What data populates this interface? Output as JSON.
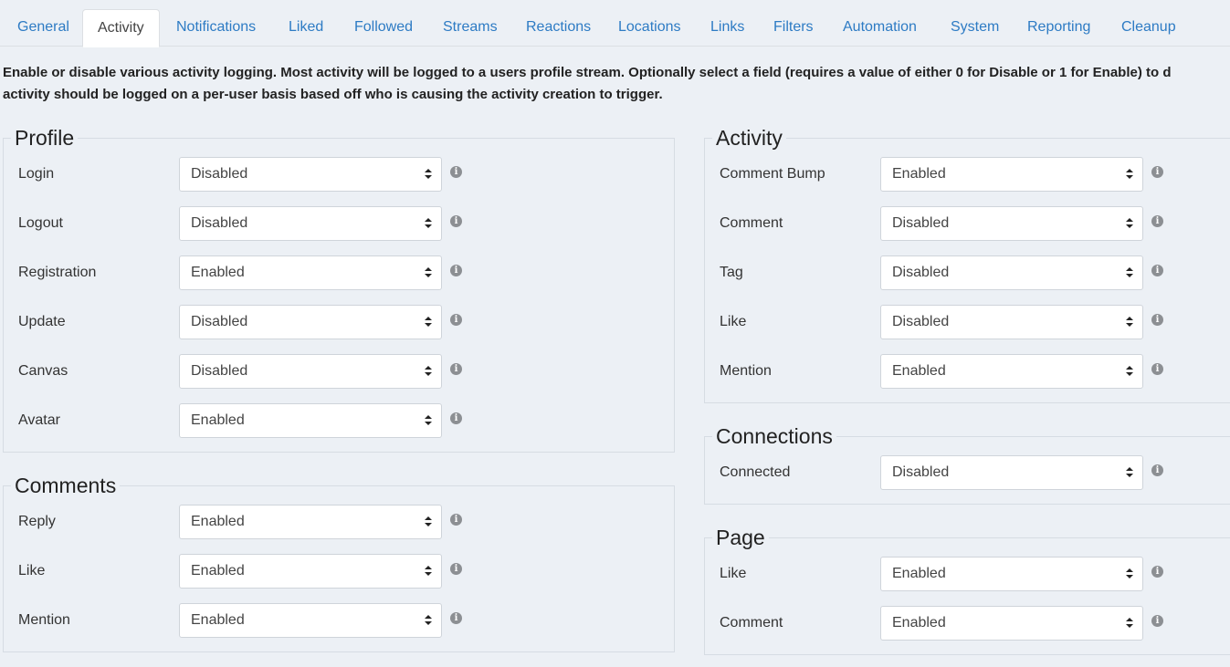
{
  "tabs": [
    {
      "label": "General"
    },
    {
      "label": "Activity"
    },
    {
      "label": "Notifications"
    },
    {
      "label": "Liked"
    },
    {
      "label": "Followed"
    },
    {
      "label": "Streams"
    },
    {
      "label": "Reactions"
    },
    {
      "label": "Locations"
    },
    {
      "label": "Links"
    },
    {
      "label": "Filters"
    },
    {
      "label": "Automation"
    },
    {
      "label": "System"
    },
    {
      "label": "Reporting"
    },
    {
      "label": "Cleanup"
    }
  ],
  "active_tab": "Activity",
  "description": {
    "line1": "Enable or disable various activity logging. Most activity will be logged to a users profile stream. Optionally select a field (requires a value of either 0 for Disable or 1 for Enable) to d",
    "line2": "activity should be logged on a per-user basis based off who is causing the activity creation to trigger."
  },
  "info_glyph": "i",
  "sections": {
    "profile": {
      "title": "Profile",
      "rows": [
        {
          "label": "Login",
          "value": "Disabled"
        },
        {
          "label": "Logout",
          "value": "Disabled"
        },
        {
          "label": "Registration",
          "value": "Enabled"
        },
        {
          "label": "Update",
          "value": "Disabled"
        },
        {
          "label": "Canvas",
          "value": "Disabled"
        },
        {
          "label": "Avatar",
          "value": "Enabled"
        }
      ]
    },
    "comments": {
      "title": "Comments",
      "rows": [
        {
          "label": "Reply",
          "value": "Enabled"
        },
        {
          "label": "Like",
          "value": "Enabled"
        },
        {
          "label": "Mention",
          "value": "Enabled"
        }
      ]
    },
    "activity": {
      "title": "Activity",
      "rows": [
        {
          "label": "Comment Bump",
          "value": "Enabled"
        },
        {
          "label": "Comment",
          "value": "Disabled"
        },
        {
          "label": "Tag",
          "value": "Disabled"
        },
        {
          "label": "Like",
          "value": "Disabled"
        },
        {
          "label": "Mention",
          "value": "Enabled"
        }
      ]
    },
    "connections": {
      "title": "Connections",
      "rows": [
        {
          "label": "Connected",
          "value": "Disabled"
        }
      ]
    },
    "page": {
      "title": "Page",
      "rows": [
        {
          "label": "Like",
          "value": "Enabled"
        },
        {
          "label": "Comment",
          "value": "Enabled"
        }
      ]
    }
  }
}
